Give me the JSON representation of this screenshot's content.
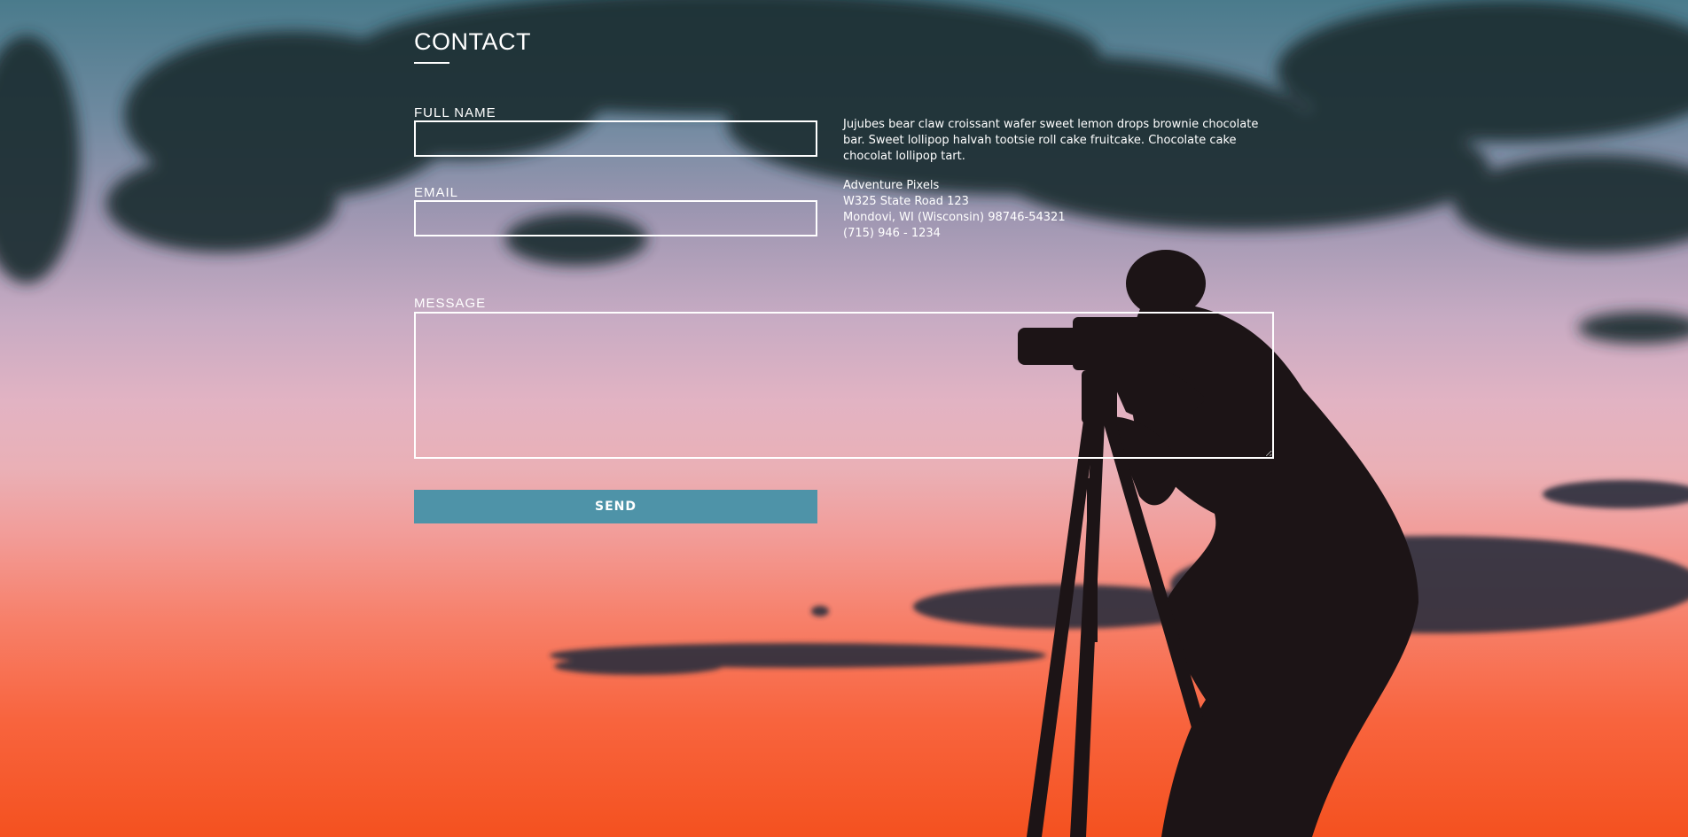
{
  "contact": {
    "title": "CONTACT"
  },
  "form": {
    "full_name_label": "FULL NAME",
    "full_name_value": "",
    "email_label": "EMAIL",
    "email_value": "",
    "message_label": "MESSAGE",
    "message_value": "",
    "send_label": "SEND"
  },
  "info": {
    "description": "Jujubes bear claw croissant wafer sweet lemon drops brownie chocolate bar. Sweet lollipop halvah tootsie roll cake fruitcake. Chocolate cake chocolat lollipop tart.",
    "company": "Adventure Pixels",
    "address_line1": "W325 State Road 123",
    "address_line2": "Mondovi, WI (Wisconsin) 98746-54321",
    "phone": "(715) 946 - 1234"
  },
  "colors": {
    "button": "#4e93a8",
    "sky_top": "#4a7b8c",
    "sky_bottom": "#f4511f",
    "silhouette": "#1c1416"
  }
}
